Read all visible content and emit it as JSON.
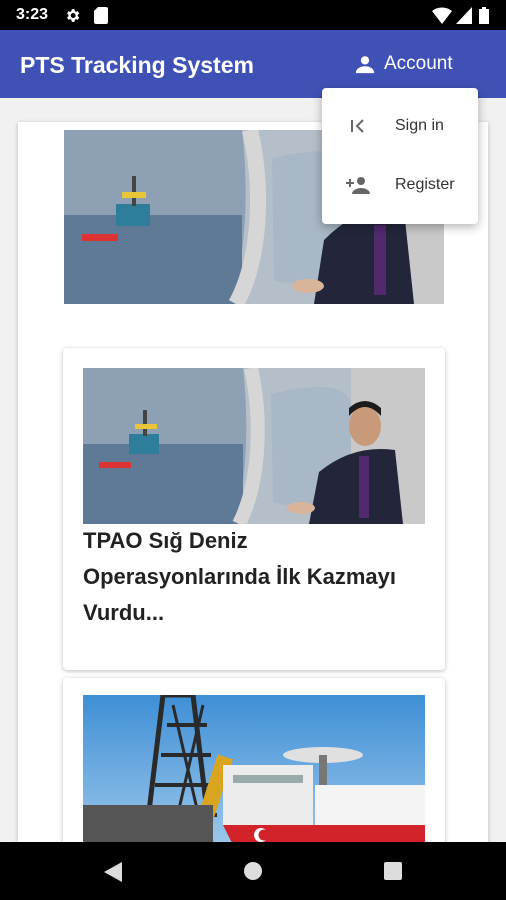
{
  "status_bar": {
    "time": "3:23",
    "icons": [
      "gear-icon",
      "sd-card-icon",
      "wifi-icon",
      "signal-icon",
      "battery-icon"
    ]
  },
  "app_bar": {
    "title": "PTS Tracking System",
    "account_label": "Account",
    "color": "#3f51b5"
  },
  "account_menu": {
    "items": [
      {
        "label": "Sign in",
        "icon": "first-page-icon"
      },
      {
        "label": "Register",
        "icon": "person-add-icon"
      }
    ]
  },
  "news_cards": [
    {
      "image": "helicopter-window-offshore-rig-photo"
    },
    {
      "image": "helicopter-window-offshore-rig-photo",
      "title": "TPAO Sığ Deniz Operasyonlarında İlk Kazmayı Vurdu..."
    },
    {
      "image": "drillship-photo"
    }
  ],
  "nav_bar": {
    "icons": [
      "back-icon",
      "home-icon",
      "recents-icon"
    ]
  }
}
